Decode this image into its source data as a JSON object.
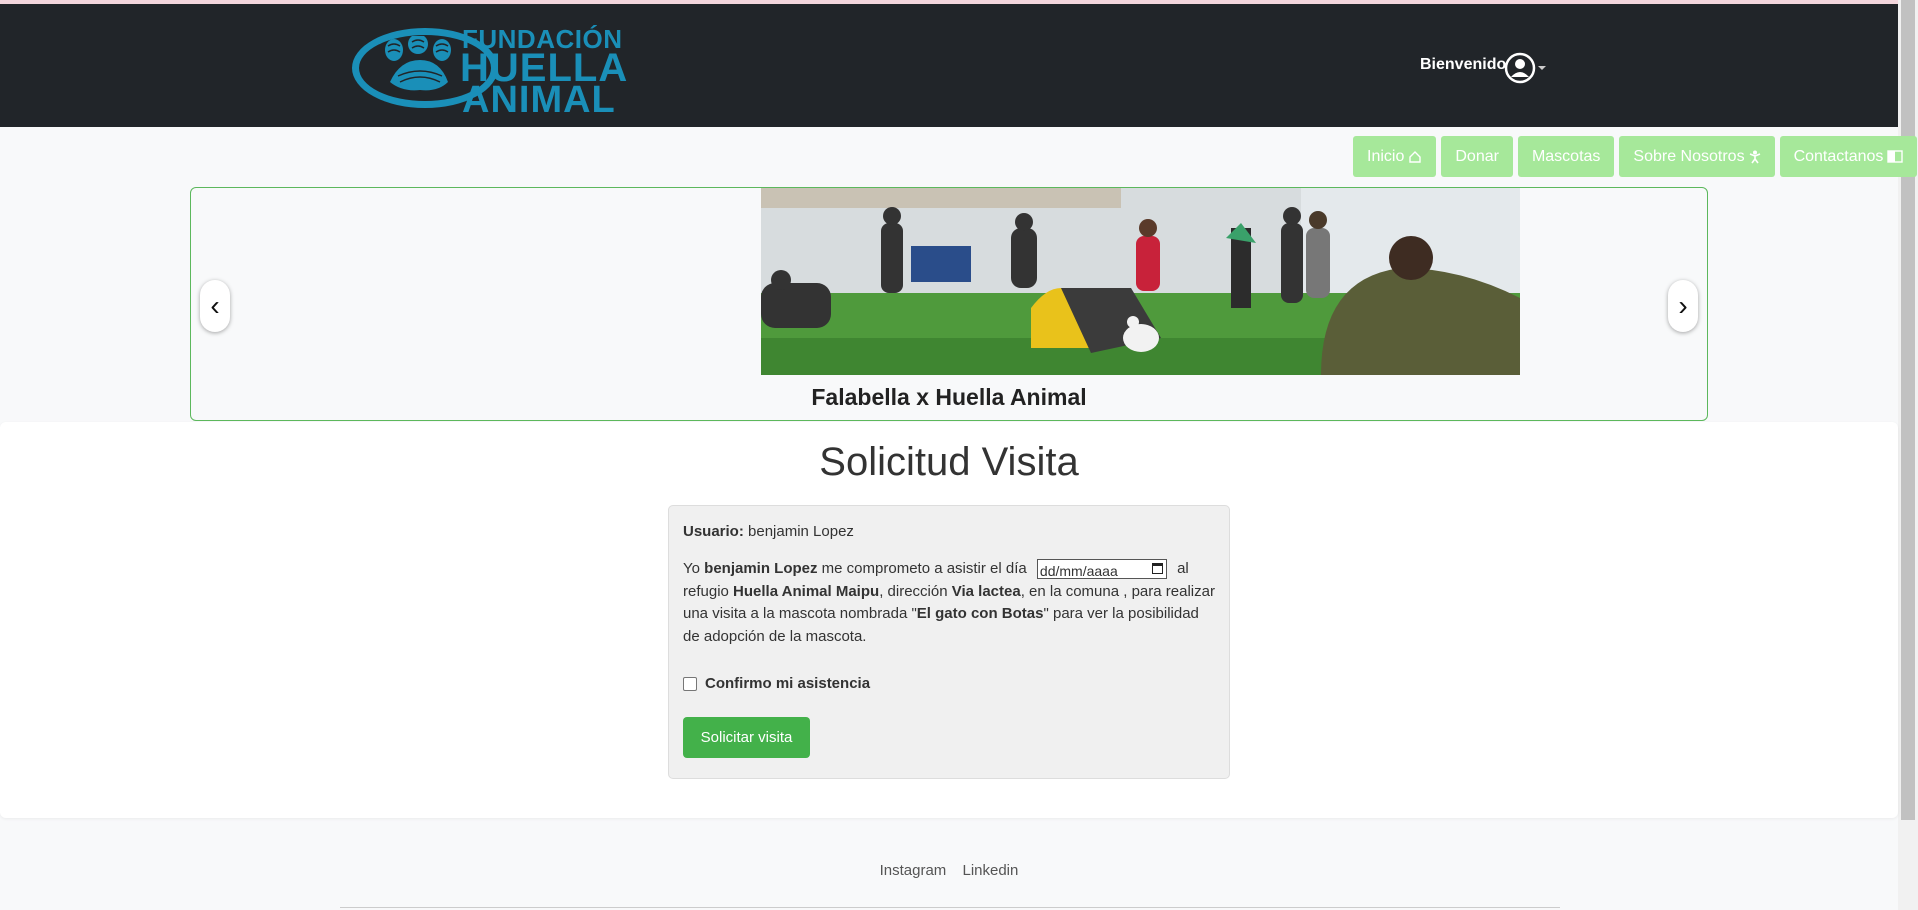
{
  "header": {
    "logo": {
      "line1": "FUNDACIÓN",
      "line2": "HUELLA",
      "line3": "ANIMAL"
    },
    "welcome": "Bienvenido",
    "user_icon": "user-circle-icon"
  },
  "nav": {
    "items": [
      {
        "label": "Inicio",
        "icon": "home-icon"
      },
      {
        "label": "Donar"
      },
      {
        "label": "Mascotas"
      },
      {
        "label": "Sobre Nosotros",
        "icon": "person-icon"
      },
      {
        "label": "Contactanos",
        "icon": "book-icon"
      }
    ],
    "color": "#a6e89a"
  },
  "carousel": {
    "caption": "Falabella x Huella Animal",
    "prev": "‹",
    "next": "›"
  },
  "form": {
    "title": "Solicitud Visita",
    "user_label": "Usuario:",
    "user_value": "benjamin Lopez",
    "t1": "Yo",
    "name": "benjamin Lopez",
    "t2": "me comprometo a asistir el día",
    "date_placeholder": "dd/mm/aaaa",
    "t3": "al refugio",
    "refugio": "Huella Animal Maipu",
    "t4": ", dirección",
    "direccion": "Via lactea",
    "t5": ", en la comuna , para realizar una visita a la mascota nombrada \"",
    "mascota": "El gato con Botas",
    "t6": "\" para ver la posibilidad de adopción de la mascota.",
    "confirm_label": "Confirmo mi asistencia",
    "submit_label": "Solicitar visita",
    "submit_color": "#43b14a"
  },
  "footer": {
    "links": [
      "Instagram",
      "Linkedin"
    ]
  }
}
